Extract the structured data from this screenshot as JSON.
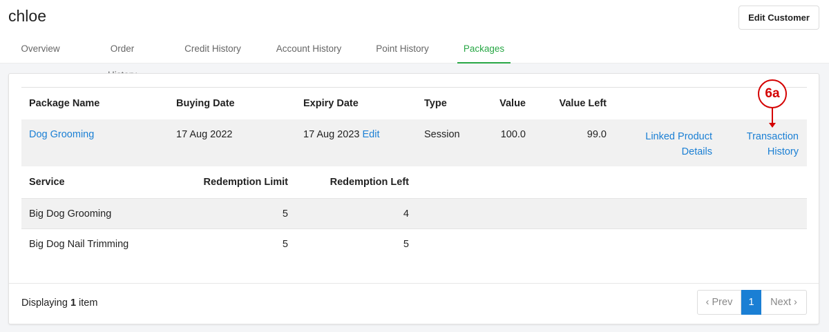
{
  "customer": {
    "name": "chloe"
  },
  "header": {
    "edit_label": "Edit Customer"
  },
  "tabs": [
    {
      "label": "Overview"
    },
    {
      "label": "Order History"
    },
    {
      "label": "Credit History"
    },
    {
      "label": "Account History"
    },
    {
      "label": "Point History"
    },
    {
      "label": "Packages",
      "active": true
    }
  ],
  "packages_table": {
    "headers": [
      "Package Name",
      "Buying Date",
      "Expiry Date",
      "Type",
      "Value",
      "Value Left"
    ],
    "rows": [
      {
        "package_name": "Dog Grooming",
        "buying_date": "17 Aug 2022",
        "expiry_date": "17 Aug 2023",
        "expiry_edit": "Edit",
        "type": "Session",
        "value": "100.0",
        "value_left": "99.0",
        "linked_product_line1": "Linked Product",
        "linked_product_line2": "Details",
        "transaction_line1": "Transaction",
        "transaction_line2": "History"
      }
    ]
  },
  "services_table": {
    "headers": [
      "Service",
      "Redemption Limit",
      "Redemption Left"
    ],
    "rows": [
      {
        "service": "Big Dog Grooming",
        "limit": "5",
        "left": "4"
      },
      {
        "service": "Big Dog Nail Trimming",
        "limit": "5",
        "left": "5"
      }
    ]
  },
  "footer": {
    "display_prefix": "Displaying",
    "display_count": "1",
    "display_suffix": "item"
  },
  "pagination": {
    "prev": "‹ Prev",
    "current": "1",
    "next": "Next ›"
  },
  "annotation": {
    "label": "6a",
    "color": "#d40000"
  },
  "colors": {
    "link": "#1a7fd4",
    "active_tab": "#28a745"
  }
}
